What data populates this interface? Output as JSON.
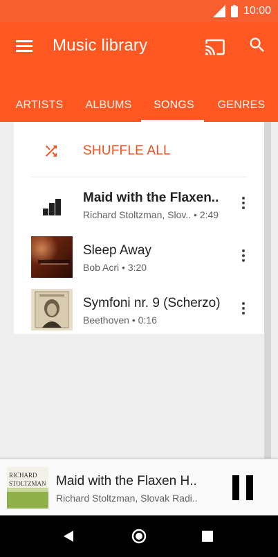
{
  "status": {
    "time": "10:00"
  },
  "appbar": {
    "title": "Music library"
  },
  "tabs": [
    {
      "label": "ARTISTS",
      "active": false
    },
    {
      "label": "ALBUMS",
      "active": false
    },
    {
      "label": "SONGS",
      "active": true
    },
    {
      "label": "GENRES",
      "active": false
    }
  ],
  "list": {
    "shuffle_label": "SHUFFLE ALL",
    "songs": [
      {
        "title": "Maid with the Flaxen..",
        "subtitle": "Richard Stoltzman, Slov.. • 2:49",
        "playing": true,
        "art": "equalizer-icon"
      },
      {
        "title": "Sleep Away",
        "subtitle": "Bob Acri • 3:20",
        "playing": false,
        "art": "album-art-sleep-away"
      },
      {
        "title": "Symfoni nr. 9 (Scherzo)",
        "subtitle": "Beethoven • 0:16",
        "playing": false,
        "art": "album-art-beethoven"
      }
    ]
  },
  "nowplaying": {
    "title": "Maid with the Flaxen H..",
    "subtitle": "Richard Stoltzman, Slovak Radi..",
    "art_text_line1": "RICHARD",
    "art_text_line2": "STOLTZMAN"
  },
  "colors": {
    "accent": "#ff5722",
    "statusbar": "#f75f2e",
    "shuffle_text": "#f4511e"
  }
}
